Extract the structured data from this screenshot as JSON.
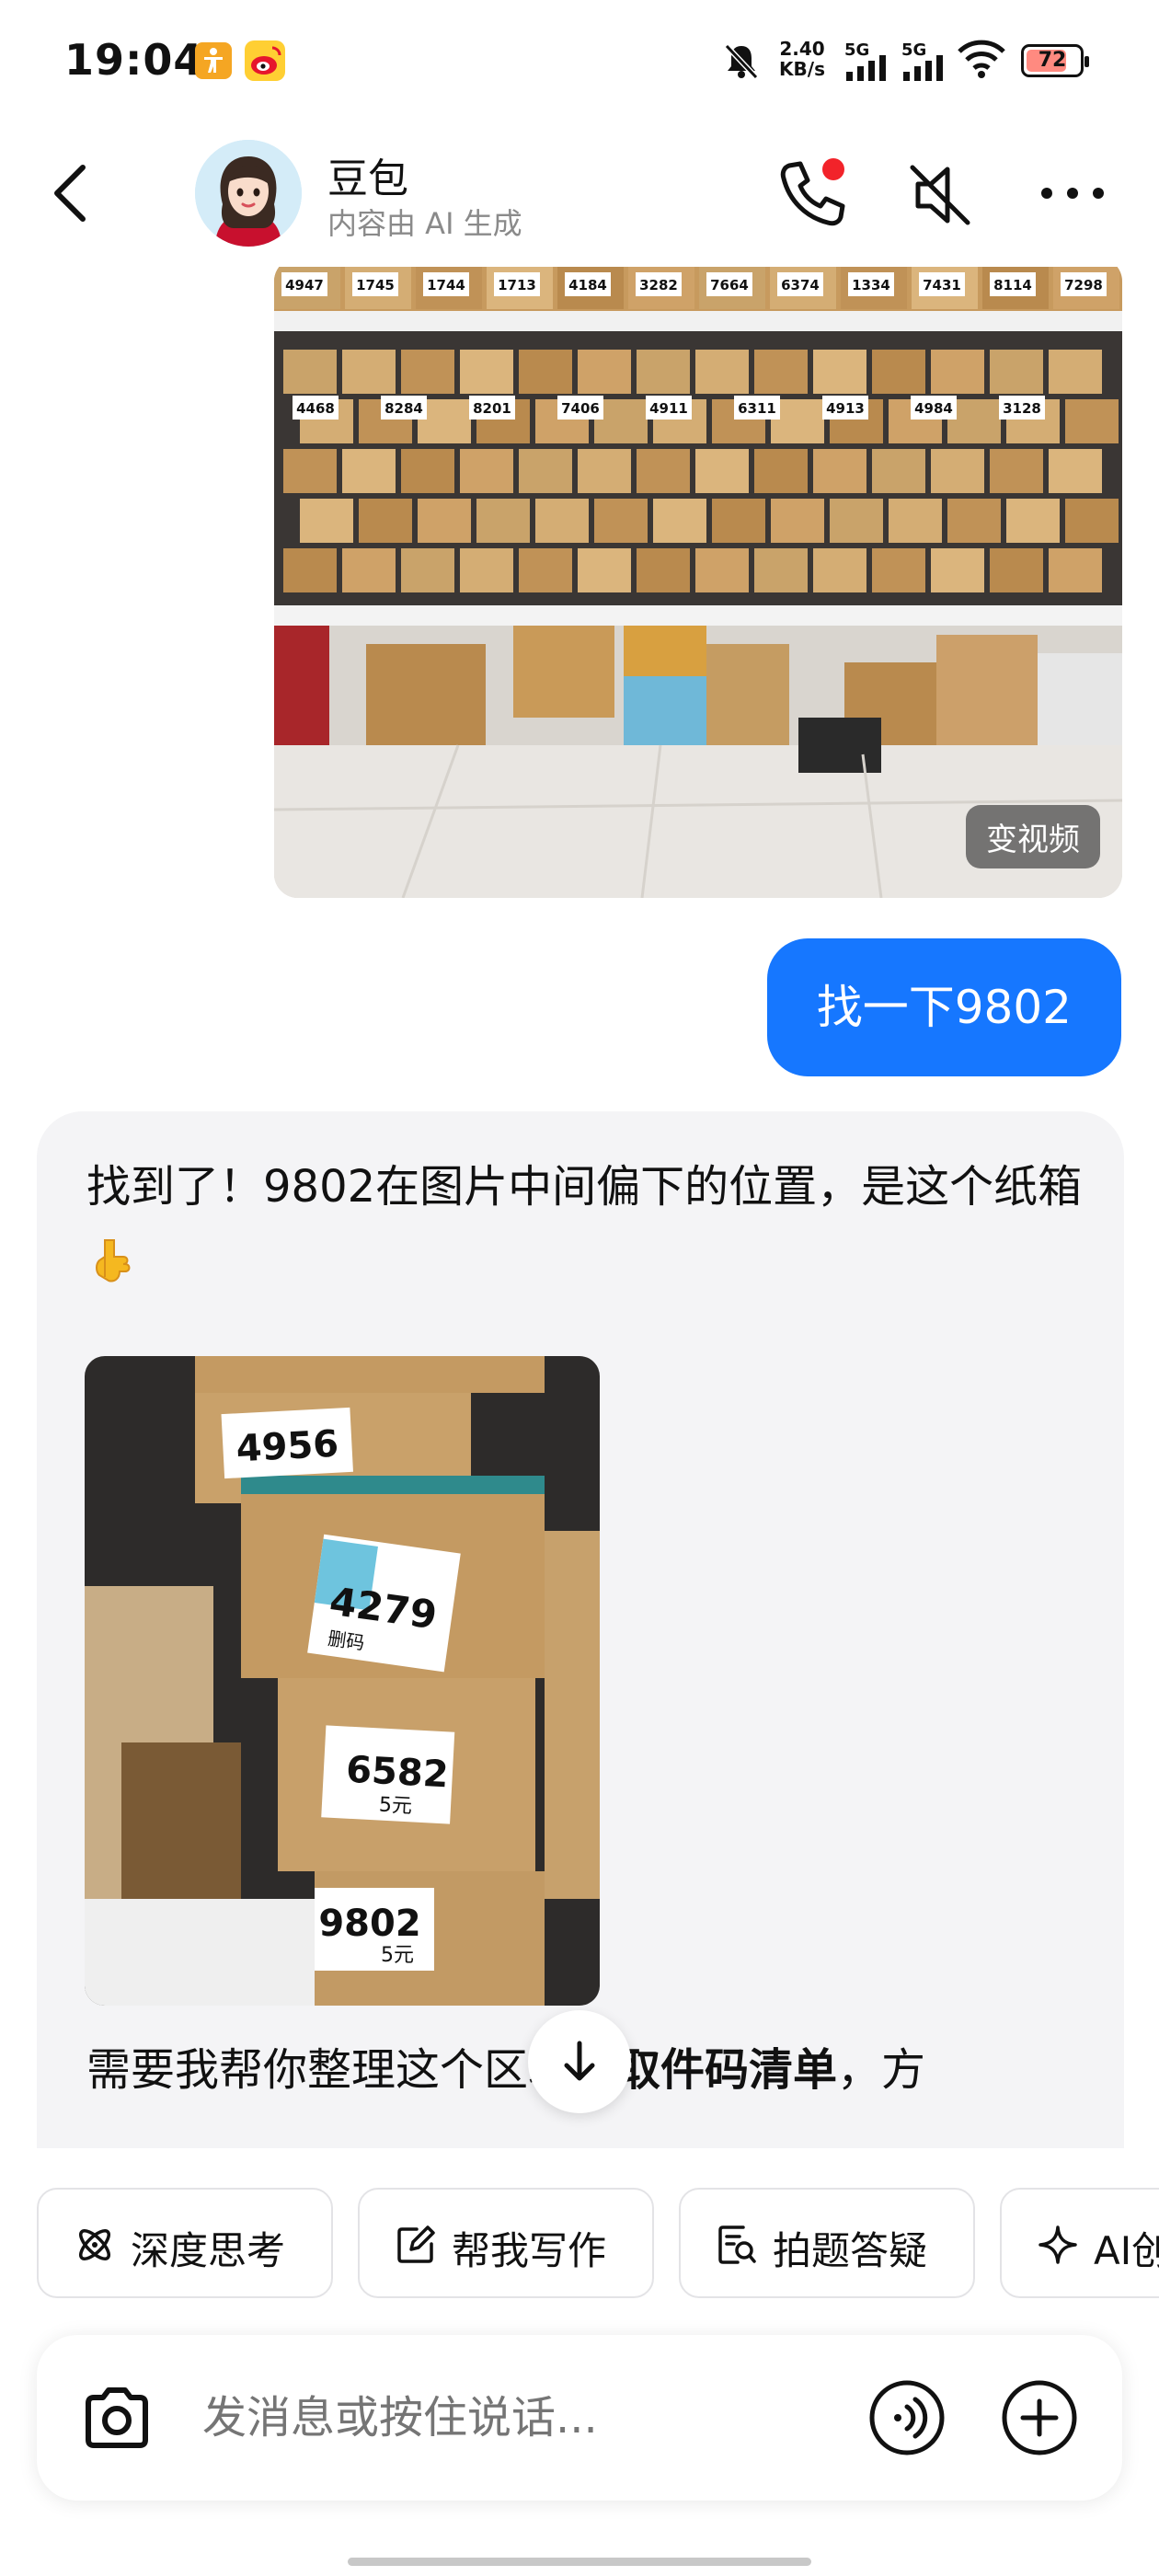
{
  "status_bar": {
    "time": "19:04",
    "net_speed_value": "2.40",
    "net_speed_unit": "KB/s",
    "signal1": "5G",
    "signal2": "5G",
    "battery": "72",
    "icons": [
      "accessibility-app-icon",
      "weibo-app-icon",
      "bell-muted-icon",
      "signal-icon",
      "wifi-icon",
      "battery-icon"
    ]
  },
  "header": {
    "name": "豆包",
    "subtitle": "内容由 AI 生成"
  },
  "chat": {
    "photo_overlay": "变视频",
    "user_message": "找一下9802",
    "bot_reply_text": "找到了！9802在图片中间偏下的位置，是这个纸箱",
    "bot_followup_before": "需要我帮你整理这个区域的",
    "bot_followup_bold": "取件码清单",
    "bot_followup_after": "，方",
    "image_labels": {
      "top": "4956",
      "middle": "4279",
      "third": "6582",
      "bottom": "9802",
      "note": "5元",
      "small": "删码"
    },
    "shelf_codes": [
      "4947",
      "1745",
      "1744",
      "1713",
      "4184",
      "3282",
      "7664",
      "6374",
      "1334",
      "7431",
      "8114",
      "7298",
      "4468",
      "8284",
      "8201",
      "7406",
      "4911",
      "6311",
      "4913",
      "4984",
      "3128"
    ]
  },
  "quick_actions": [
    {
      "label": "深度思考",
      "icon": "atom-icon"
    },
    {
      "label": "帮我写作",
      "icon": "edit-icon"
    },
    {
      "label": "拍题答疑",
      "icon": "scan-doc-icon"
    },
    {
      "label": "AI创作",
      "icon": "sparkle-icon"
    }
  ],
  "input": {
    "placeholder": "发消息或按住说话..."
  },
  "colors": {
    "accent": "#1677ff",
    "bot_bg": "#f4f4f6",
    "call_dot": "#f2232a",
    "battery_fill": "#ff8a80"
  }
}
